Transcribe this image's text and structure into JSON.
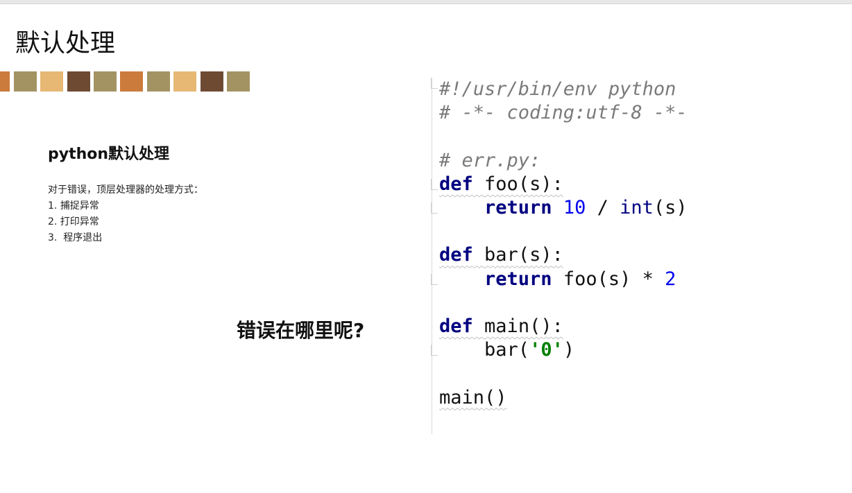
{
  "slide": {
    "title": "默认处理",
    "subtitle": "python默认处理",
    "description": [
      "对于错误，顶层处理器的处理方式：",
      "1. 捕捉异常",
      "2. 打印异常",
      "3.  程序退出"
    ],
    "question": "错误在哪里呢?"
  },
  "swatch_colors": [
    "#cb7b3c",
    "#a39363",
    "#e7b874",
    "#6e4a33",
    "#a39363",
    "#cb7b3c",
    "#a39363",
    "#e7b874",
    "#6e4a33",
    "#a39363"
  ],
  "code": {
    "line1": "#!/usr/bin/env python",
    "line2": "# -*- coding:utf-8 -*-",
    "line4": "# err.py:",
    "kw_def": "def",
    "kw_return": "return",
    "foo_sig": "foo(s):",
    "ten": "10",
    "div": " / ",
    "int": "int",
    "s_paren": "(s)",
    "bar_sig": "bar(s):",
    "foo_call": "foo(s) * ",
    "two": "2",
    "main_sig": "main():",
    "bar_open": "bar(",
    "zero_str": "'0'",
    "bar_close": ")",
    "main_call": "main()"
  }
}
